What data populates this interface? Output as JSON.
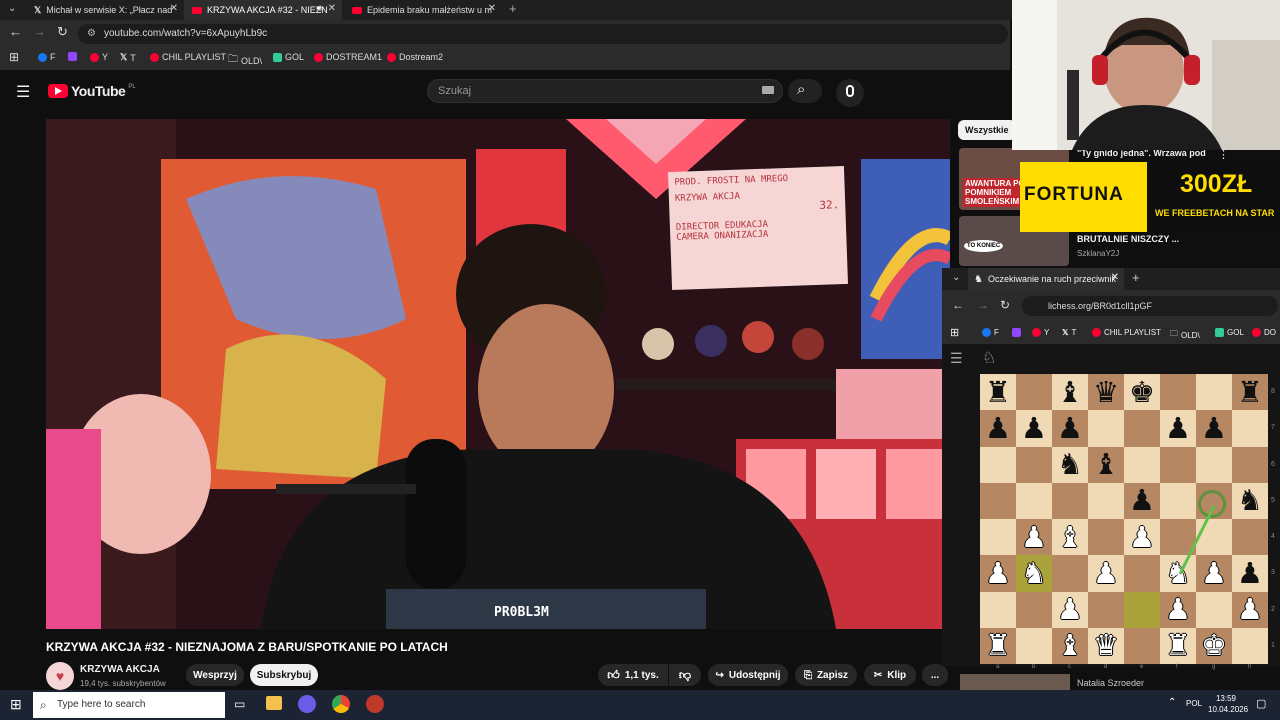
{
  "browser": {
    "tabs": [
      {
        "label": "Michał w serwisie X: „Płacz nad"
      },
      {
        "label": "KRZYWA AKCJA #32 - NIEZN"
      },
      {
        "label": "Epidemia braku małżeństw u m"
      }
    ],
    "url": "youtube.com/watch?v=6xApuyhLb9c",
    "bookmarks": [
      "F",
      "Y",
      "T",
      "CHIL PLAYLIST",
      "OLD\\",
      "GOL",
      "DOSTREAM1",
      "Dostream2"
    ]
  },
  "youtube": {
    "logo": "YouTube",
    "region": "PL",
    "search_placeholder": "Szukaj",
    "video_title": "KRZYWA AKCJA #32 - NIEZNAJOMA Z BARU/SPOTKANIE PO LATACH",
    "channel_name": "KRZYWA AKCJA",
    "subscribers": "19,4 tys. subskrybentów",
    "support_label": "Wesprzyj",
    "subscribe_label": "Subskrybuj",
    "likes": "1,1 tys.",
    "share_label": "Udostępnij",
    "save_label": "Zapisz",
    "clip_label": "Klip",
    "more_label": "...",
    "set_card": {
      "line1": "PROD. FROSTI NA MREGO",
      "line2": "KRZYWA AKCJA",
      "line3": "32.",
      "line4": "DIRECTOR EDUKACJA",
      "line5": "CAMERA ONANIZACJA"
    },
    "laptop_text": "PR0BL3M"
  },
  "sidebar": {
    "chip_label": "Wszystkie",
    "items": [
      {
        "title": "\"Ty gnido jedna\". Wrzawa pod",
        "thumb_text": "AWANTURA POD POMNIKIEM SMOLEŃSKIM"
      },
      {
        "title": "BRUTALNIE NISZCZY ...",
        "channel": "SzklanaY2J",
        "thumb_text": "TO KONIEC"
      }
    ],
    "bottom_channel": "Natalia Szroeder"
  },
  "ad": {
    "brand": "FORTUNA",
    "amount": "300ZŁ",
    "tagline": "WE FREEBETACH NA STAR"
  },
  "lichess_popup": {
    "tab_title": "Oczekiwanie na ruch przeciwnik",
    "url": "lichess.org/BR0d1cll1pGF",
    "bookmarks": [
      "F",
      "Y",
      "T",
      "CHIL PLAYLIST",
      "OLD\\",
      "GOL",
      "DO"
    ],
    "files": [
      "a",
      "b",
      "c",
      "d",
      "e",
      "f",
      "g",
      "h"
    ],
    "ranks": [
      "8",
      "7",
      "6",
      "5",
      "4",
      "3",
      "2",
      "1"
    ],
    "board": [
      "r.bqk..r",
      "ppp..pp.",
      "..nb....",
      "....p..n",
      ".PB.P...",
      "PN.P.NPp",
      "..P..P.P",
      "R.BQ.RK."
    ],
    "highlight": [
      "b3",
      "e2"
    ]
  },
  "taskbar": {
    "search_placeholder": "Type here to search",
    "lang": "POL",
    "time": "13:59",
    "date": "10.04.2026"
  }
}
